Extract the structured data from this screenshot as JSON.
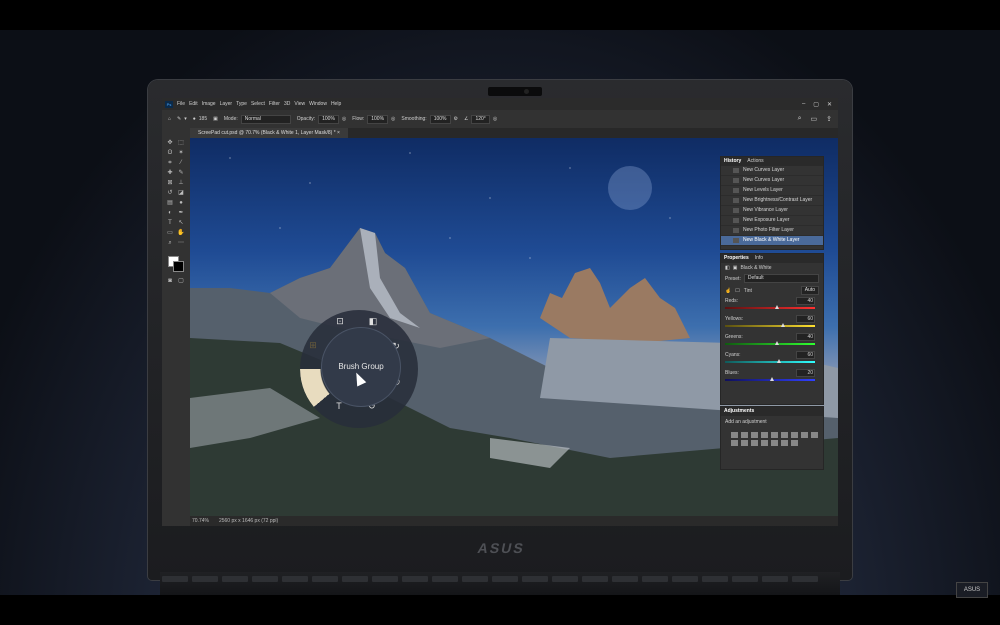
{
  "menu": {
    "app_badge": "Ps",
    "items": [
      "File",
      "Edit",
      "Image",
      "Layer",
      "Type",
      "Select",
      "Filter",
      "3D",
      "View",
      "Window",
      "Help"
    ],
    "window_controls": [
      "–",
      "▢",
      "✕"
    ]
  },
  "options": {
    "brush_size": "185",
    "mode_label": "Mode:",
    "mode_value": "Normal",
    "opacity_label": "Opacity:",
    "opacity_value": "100%",
    "flow_label": "Flow:",
    "flow_value": "100%",
    "smoothing_label": "Smoothing:",
    "smoothing_value": "100%",
    "angle_value": "120°"
  },
  "document": {
    "tab_title": "ScreePad cut.psd @ 70.7% (Black & White 1, Layer Mask/8) *",
    "tab_close": "×",
    "zoom": "70.74%",
    "dimensions": "2560 px x 1646 px (72 ppi)"
  },
  "radial_menu": {
    "center_label": "Brush Group"
  },
  "history": {
    "tabs": [
      "History",
      "Actions"
    ],
    "rows": [
      "New Curves Layer",
      "New Curves Layer",
      "New Levels Layer",
      "New Brightness/Contrast Layer",
      "New Vibrance Layer",
      "New Exposure Layer",
      "New Photo Filter Layer",
      "New Black & White Layer"
    ],
    "selected_index": 7
  },
  "properties": {
    "tabs": [
      "Properties",
      "Info"
    ],
    "adjustment_name": "Black & White",
    "preset_label": "Preset:",
    "preset_value": "Default",
    "tint_label": "Tint",
    "auto_label": "Auto",
    "sliders": [
      {
        "label": "Reds:",
        "value": "40",
        "fraction": 0.55,
        "gradient": "linear-gradient(90deg,#5a1010,#ff3030)"
      },
      {
        "label": "Yellows:",
        "value": "60",
        "fraction": 0.62,
        "gradient": "linear-gradient(90deg,#5a5010,#ffe030)"
      },
      {
        "label": "Greens:",
        "value": "40",
        "fraction": 0.55,
        "gradient": "linear-gradient(90deg,#105a10,#30ff30)"
      },
      {
        "label": "Cyans:",
        "value": "60",
        "fraction": 0.58,
        "gradient": "linear-gradient(90deg,#105a5a,#30ffff)"
      },
      {
        "label": "Blues:",
        "value": "20",
        "fraction": 0.5,
        "gradient": "linear-gradient(90deg,#10105a,#3040ff)"
      }
    ]
  },
  "adjustments": {
    "title": "Adjustments",
    "subtitle": "Add an adjustment"
  },
  "hardware": {
    "brand": "ASUS",
    "corner_badge": "ASUS"
  }
}
